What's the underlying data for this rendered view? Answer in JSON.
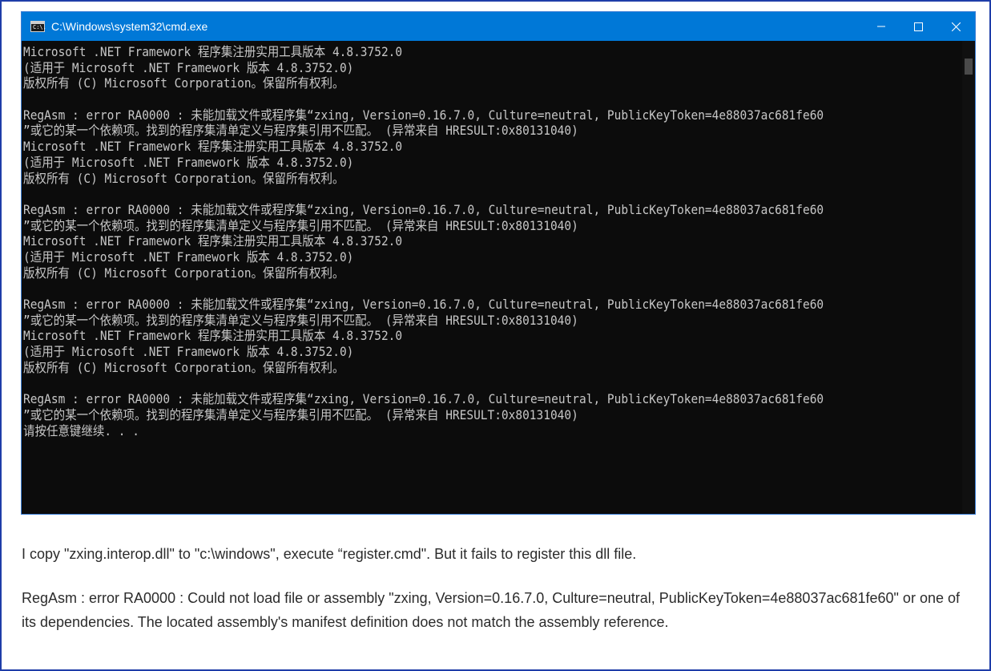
{
  "window": {
    "title": "C:\\Windows\\system32\\cmd.exe",
    "icon_text": "C:\\.",
    "controls": {
      "minimize": "—",
      "maximize": "☐",
      "close": "✕"
    }
  },
  "console_lines": [
    "Microsoft .NET Framework 程序集注册实用工具版本 4.8.3752.0",
    "(适用于 Microsoft .NET Framework 版本 4.8.3752.0)",
    "版权所有 (C) Microsoft Corporation。保留所有权利。",
    "",
    "RegAsm : error RA0000 : 未能加载文件或程序集“zxing, Version=0.16.7.0, Culture=neutral, PublicKeyToken=4e88037ac681fe60",
    "”或它的某一个依赖项。找到的程序集清单定义与程序集引用不匹配。 (异常来自 HRESULT:0x80131040)",
    "Microsoft .NET Framework 程序集注册实用工具版本 4.8.3752.0",
    "(适用于 Microsoft .NET Framework 版本 4.8.3752.0)",
    "版权所有 (C) Microsoft Corporation。保留所有权利。",
    "",
    "RegAsm : error RA0000 : 未能加载文件或程序集“zxing, Version=0.16.7.0, Culture=neutral, PublicKeyToken=4e88037ac681fe60",
    "”或它的某一个依赖项。找到的程序集清单定义与程序集引用不匹配。 (异常来自 HRESULT:0x80131040)",
    "Microsoft .NET Framework 程序集注册实用工具版本 4.8.3752.0",
    "(适用于 Microsoft .NET Framework 版本 4.8.3752.0)",
    "版权所有 (C) Microsoft Corporation。保留所有权利。",
    "",
    "RegAsm : error RA0000 : 未能加载文件或程序集“zxing, Version=0.16.7.0, Culture=neutral, PublicKeyToken=4e88037ac681fe60",
    "”或它的某一个依赖项。找到的程序集清单定义与程序集引用不匹配。 (异常来自 HRESULT:0x80131040)",
    "Microsoft .NET Framework 程序集注册实用工具版本 4.8.3752.0",
    "(适用于 Microsoft .NET Framework 版本 4.8.3752.0)",
    "版权所有 (C) Microsoft Corporation。保留所有权利。",
    "",
    "RegAsm : error RA0000 : 未能加载文件或程序集“zxing, Version=0.16.7.0, Culture=neutral, PublicKeyToken=4e88037ac681fe60",
    "”或它的某一个依赖项。找到的程序集清单定义与程序集引用不匹配。 (异常来自 HRESULT:0x80131040)",
    "请按任意键继续. . ."
  ],
  "post": {
    "paragraph_1": "I copy \"zxing.interop.dll\" to \"c:\\windows\", execute “register.cmd\". But it fails to register this dll file.",
    "paragraph_2": "RegAsm : error RA0000 : Could not load file or assembly \"zxing, Version=0.16.7.0, Culture=neutral, PublicKeyToken=4e88037ac681fe60\" or one of its dependencies. The located assembly's manifest definition does not match the assembly reference."
  },
  "colors": {
    "titlebar": "#0078d7",
    "console_bg": "#0c0c0c",
    "console_text": "#c7c7c7",
    "frame_border": "#1f3da8"
  }
}
